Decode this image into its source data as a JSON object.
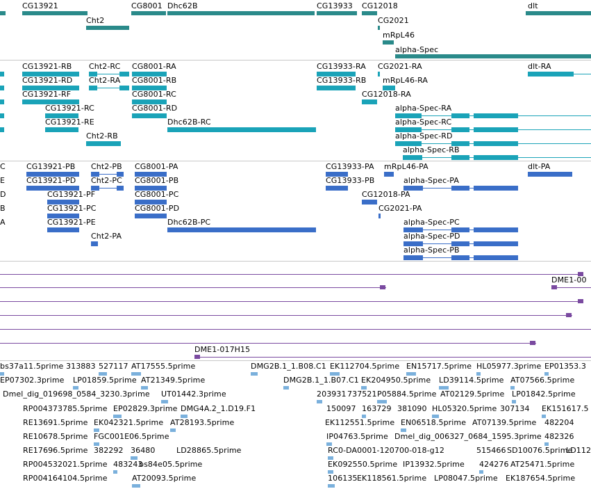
{
  "colors": {
    "gene": "#2a8a8a",
    "transcript": "#1aa3b8",
    "cds": "#3a6ec8",
    "assembly": "#7a4aa0",
    "est": "#7ab0dc"
  },
  "gene_track": {
    "labels": [
      "CG13921",
      "Cht2",
      "CG8001",
      "Dhc62B",
      "CG13933",
      "CG12018",
      "CG2021",
      "mRpL46",
      "alpha-Spec",
      "dlt"
    ]
  },
  "transcript_track": {
    "labels": [
      "CG13921-RB",
      "Cht2-RC",
      "CG8001-RA",
      "CG13933-RA",
      "CG2021-RA",
      "dlt-RA",
      "CG13921-RD",
      "Cht2-RA",
      "CG8001-RB",
      "CG13933-RB",
      "mRpL46-RA",
      "CG13921-RF",
      "CG8001-RC",
      "CG12018-RA",
      "CG13921-RC",
      "CG8001-RD",
      "alpha-Spec-RA",
      "CG13921-RE",
      "Dhc62B-RC",
      "alpha-Spec-RC",
      "Cht2-RB",
      "alpha-Spec-RD",
      "alpha-Spec-RB"
    ]
  },
  "cds_track": {
    "edge_letters": [
      "C",
      "E",
      "D",
      "B",
      "A"
    ],
    "labels": [
      "CG13921-PB",
      "Cht2-PB",
      "CG8001-PA",
      "CG13933-PA",
      "mRpL46-PA",
      "dlt-PA",
      "CG13921-PD",
      "Cht2-PC",
      "CG8001-PB",
      "CG13933-PB",
      "alpha-Spec-PA",
      "CG13921-PF",
      "CG8001-PC",
      "CG12018-PA",
      "CG13921-PC",
      "CG8001-PD",
      "CG2021-PA",
      "CG13921-PE",
      "Dhc62B-PC",
      "alpha-Spec-PC",
      "Cht2-PA",
      "alpha-Spec-PD",
      "alpha-Spec-PB"
    ]
  },
  "assembly_track": {
    "labels": [
      "DME1-00",
      "DME1-017H15"
    ]
  },
  "est_track": {
    "rows": [
      [
        "bs37a11.5prime",
        "313883",
        "527117",
        "AT17555.5prime",
        "DMG2B.1_1.B08.C1",
        "EK112704.5prime",
        "EN15717.5prime",
        "HL05977.3prime",
        "EP01353.3"
      ],
      [
        "EP07302.3prime",
        "LP01859.5prime",
        "AT21349.5prime",
        "DMG2B.1_1.B07.C1",
        "EK204950.5prime",
        "LD39114.5prime",
        "AT07566.5prime"
      ],
      [
        "Dmel_dig_019698_0584_3230.3prime",
        "UT01442.3prime",
        "203931",
        "737521",
        "P05884.5prime",
        "AT02129.5prime",
        "LP01842.5prime"
      ],
      [
        "RP004373785.5prime",
        "EP02829.3prime",
        "DMG4A.2_1.D19.F1",
        "150097",
        "163729",
        "381090",
        "HL05320.5prime",
        "307134",
        "EK151617.5"
      ],
      [
        "RE13691.5prime",
        "EK042321.5prime",
        "AT28193.5prime",
        "EK112551.5prime",
        "EN06518.5prime",
        "AT07139.5prime",
        "482204"
      ],
      [
        "RE10678.5prime",
        "FGC001E06.5prime",
        "IP04763.5prime",
        "Dmel_dig_006327_0684_1595.3prime",
        "482326"
      ],
      [
        "RE17696.5prime",
        "382292",
        "36480",
        "LD28865.5prime",
        "RC0-DA0001-120700-018-g12",
        "515466",
        "SD10076.5prime",
        "LD112"
      ],
      [
        "RP004532021.5prime",
        "483243",
        "bs84e05.5prime",
        "EK092550.5prime",
        "IP13932.5prime",
        "424276",
        "AT25471.5prime"
      ],
      [
        "RP004164104.5prime",
        "AT20093.5prime",
        "106135",
        "EK118561.5prime",
        "LP08047.5prime",
        "EK187654.5prime"
      ]
    ]
  }
}
